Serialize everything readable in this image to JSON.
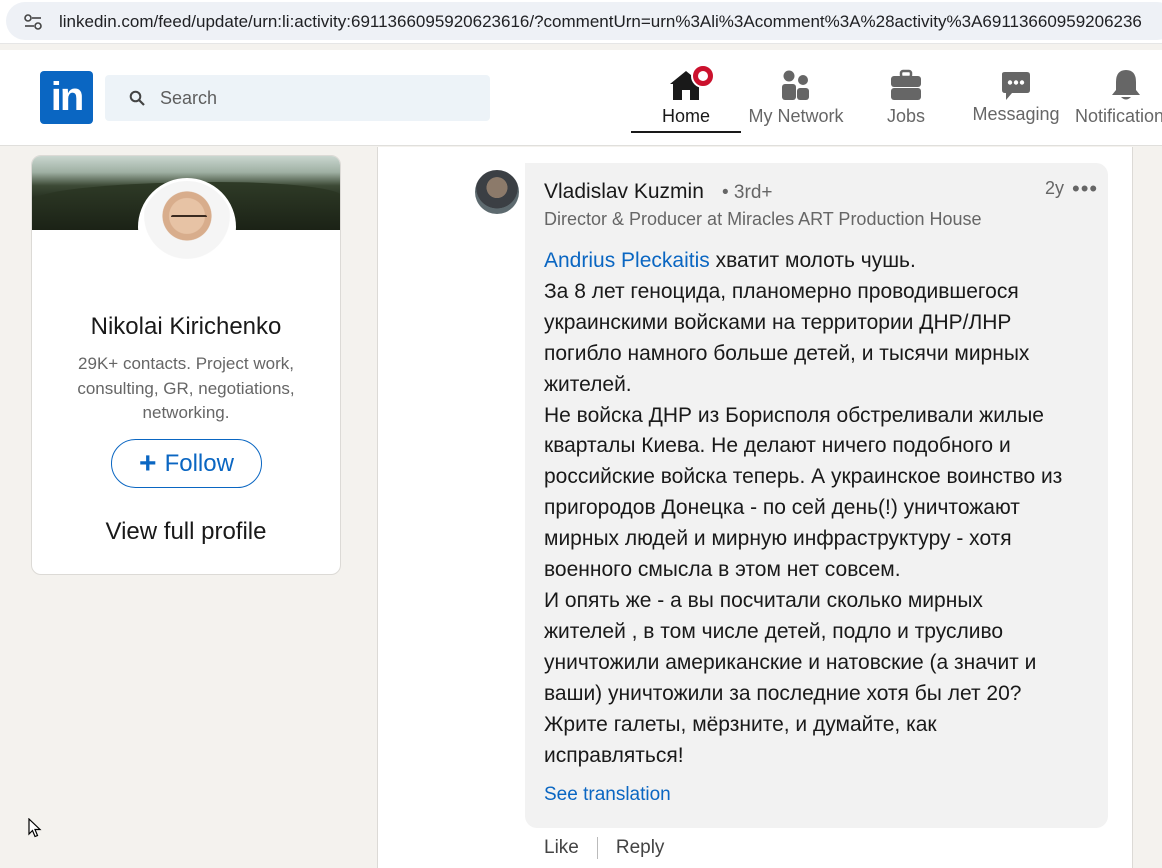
{
  "browser": {
    "url": "linkedin.com/feed/update/urn:li:activity:6911366095920623616/?commentUrn=urn%3Ali%3Acomment%3A%28activity%3A69113660959206236"
  },
  "nav": {
    "logo_text": "in",
    "search_placeholder": "Search",
    "items": [
      {
        "label": "Home",
        "icon": "home-icon",
        "active": true
      },
      {
        "label": "My Network",
        "icon": "network-icon"
      },
      {
        "label": "Jobs",
        "icon": "briefcase-icon"
      },
      {
        "label": "Messaging",
        "icon": "messaging-icon"
      },
      {
        "label": "Notifications",
        "icon": "bell-icon"
      }
    ]
  },
  "profile": {
    "name": "Nikolai Kirichenko",
    "headline": "29K+ contacts. Project work, consulting, GR, negotiations, networking.",
    "follow_label": "Follow",
    "view_profile_label": "View full profile"
  },
  "comment": {
    "author": "Vladislav Kuzmin",
    "degree": "• 3rd+",
    "title": "Director & Producer at Miracles ART Production House",
    "time": "2y",
    "mention": "Andrius Pleckaitis",
    "first_line_rest": " хватит молоть чушь.",
    "lines": [
      "За 8 лет геноцида, планомерно проводившегося",
      "украинскими войсками на территории ДНР/ЛНР",
      "погибло намного больше детей, и тысячи мирных",
      "жителей.",
      "Не войска ДНР из Борисполя обстреливали жилые",
      "кварталы Киева. Не делают ничего подобного и",
      "российские войска теперь. А украинское воинство из",
      "пригородов Донецка - по сей день(!) уничтожают",
      "мирных людей и мирную инфраструктуру - хотя",
      "военного смысла в этом нет совсем.",
      "И опять же - а вы посчитали сколько мирных",
      "жителей , в том числе детей, подло и трусливо",
      "уничтожили американские и натовские (а значит и",
      "ваши) уничтожили за последние хотя бы лет 20?",
      "Жрите галеты, мёрзните, и думайте, как",
      "исправляться!"
    ],
    "see_translation": "See translation",
    "like_label": "Like",
    "reply_label": "Reply"
  },
  "colors": {
    "brand": "#0a66c2",
    "notification_badge": "#cb112d"
  }
}
